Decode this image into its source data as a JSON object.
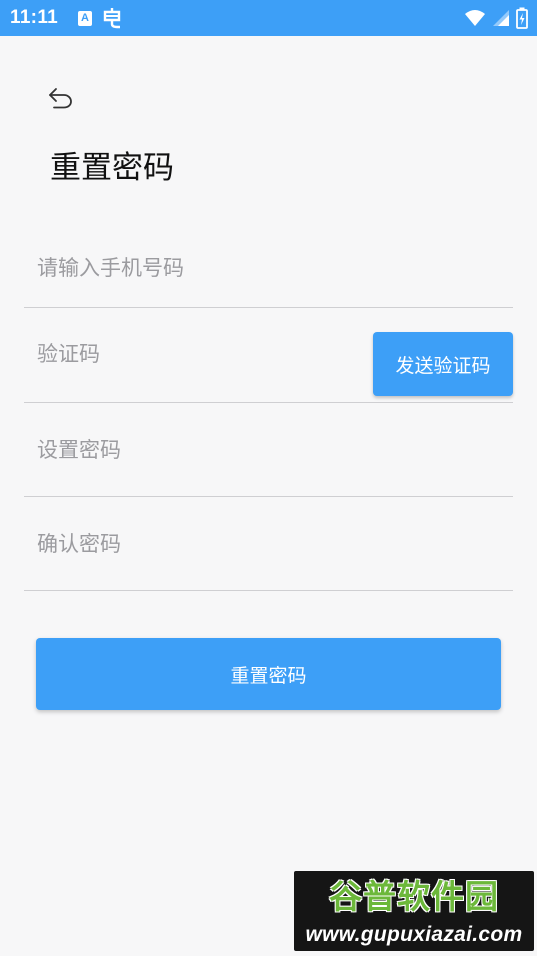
{
  "status_bar": {
    "time": "11:11",
    "notification_a": "A",
    "notification_icons": [
      "a-notification-icon",
      "bug-icon"
    ],
    "system_icons": [
      "wifi-icon",
      "cellular-signal-icon",
      "battery-icon"
    ],
    "background_color": "#3d9ff7"
  },
  "header": {
    "back_icon": "back-arrow-icon",
    "title": "重置密码"
  },
  "form": {
    "phone": {
      "placeholder": "请输入手机号码",
      "value": ""
    },
    "verification_code": {
      "placeholder": "验证码",
      "value": ""
    },
    "send_code_label": "发送验证码",
    "new_password": {
      "placeholder": "设置密码",
      "value": ""
    },
    "confirm_password": {
      "placeholder": "确认密码",
      "value": ""
    },
    "submit_label": "重置密码"
  },
  "watermark": {
    "title": "谷普软件园",
    "url": "www.gupuxiazai.com"
  },
  "colors": {
    "accent": "#3d9ff7",
    "background": "#f7f7f8",
    "divider": "#cfcfd2",
    "placeholder": "#9b9b9f"
  }
}
